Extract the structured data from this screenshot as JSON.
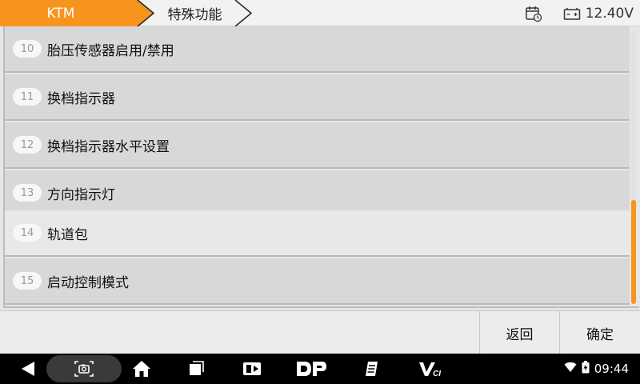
{
  "header": {
    "breadcrumb_home": "KTM",
    "breadcrumb_current": "特殊功能",
    "battery_voltage": "12.40V",
    "accent_color": "#f7941d"
  },
  "list": {
    "items": [
      {
        "num": "10",
        "label": "胎压传感器启用/禁用"
      },
      {
        "num": "11",
        "label": "换档指示器"
      },
      {
        "num": "12",
        "label": "换档指示器水平设置"
      },
      {
        "num": "13",
        "label": "方向指示灯"
      },
      {
        "num": "14",
        "label": "轨道包"
      },
      {
        "num": "15",
        "label": "启动控制模式"
      }
    ]
  },
  "actions": {
    "back_label": "返回",
    "ok_label": "确定"
  },
  "system": {
    "time": "09:44",
    "icons": [
      "back-icon",
      "screenshot-icon",
      "home-icon",
      "recent-apps-icon",
      "remote-icon",
      "dp-icon",
      "notes-icon",
      "vci-icon",
      "wifi-icon",
      "battery-icon"
    ],
    "vci_label": "VCI"
  }
}
